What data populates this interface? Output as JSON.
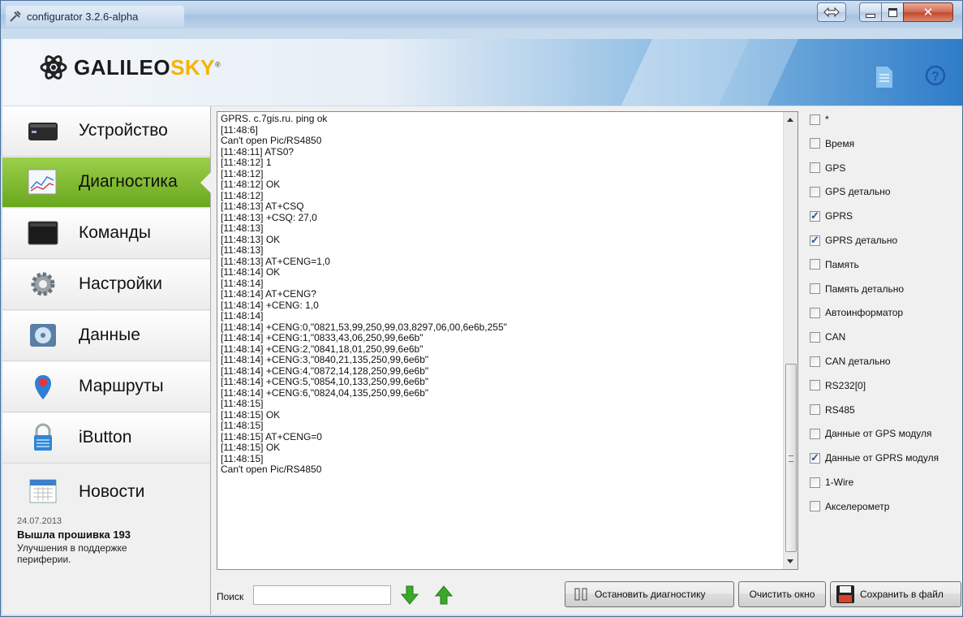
{
  "window": {
    "title": "configurator 3.2.6-alpha"
  },
  "brand": {
    "name_part1": "GALILEO",
    "name_part2": "SKY",
    "registered": "®"
  },
  "sidebar": {
    "items": [
      {
        "label": "Устройство",
        "icon": "device-icon",
        "active": false
      },
      {
        "label": "Диагностика",
        "icon": "chart-icon",
        "active": true
      },
      {
        "label": "Команды",
        "icon": "terminal-icon",
        "active": false
      },
      {
        "label": "Настройки",
        "icon": "gear-icon",
        "active": false
      },
      {
        "label": "Данные",
        "icon": "disk-icon",
        "active": false
      },
      {
        "label": "Маршруты",
        "icon": "map-pin-icon",
        "active": false
      },
      {
        "label": "iButton",
        "icon": "lock-icon",
        "active": false
      },
      {
        "label": "Новости",
        "icon": "calendar-icon",
        "active": false
      }
    ],
    "news": {
      "date": "24.07.2013",
      "title": "Вышла прошивка 193",
      "body": "Улучшения в поддержке периферии."
    }
  },
  "log": {
    "lines": [
      "GPRS. c.7gis.ru. ping ok",
      "[11:48:6]",
      "Can't open Pic/RS4850",
      "[11:48:11] ATS0?",
      "[11:48:12] 1",
      "[11:48:12]",
      "[11:48:12] OK",
      "[11:48:12]",
      "[11:48:13] AT+CSQ",
      "[11:48:13] +CSQ: 27,0",
      "[11:48:13]",
      "[11:48:13] OK",
      "[11:48:13]",
      "[11:48:13] AT+CENG=1,0",
      "[11:48:14] OK",
      "[11:48:14]",
      "[11:48:14] AT+CENG?",
      "[11:48:14] +CENG: 1,0",
      "[11:48:14]",
      "[11:48:14] +CENG:0,\"0821,53,99,250,99,03,8297,06,00,6e6b,255\"",
      "[11:48:14] +CENG:1,\"0833,43,06,250,99,6e6b\"",
      "[11:48:14] +CENG:2,\"0841,18,01,250,99,6e6b\"",
      "[11:48:14] +CENG:3,\"0840,21,135,250,99,6e6b\"",
      "[11:48:14] +CENG:4,\"0872,14,128,250,99,6e6b\"",
      "[11:48:14] +CENG:5,\"0854,10,133,250,99,6e6b\"",
      "[11:48:14] +CENG:6,\"0824,04,135,250,99,6e6b\"",
      "[11:48:15]",
      "[11:48:15] OK",
      "[11:48:15]",
      "[11:48:15] AT+CENG=0",
      "[11:48:15] OK",
      "[11:48:15]",
      "Can't open Pic/RS4850"
    ]
  },
  "filters": [
    {
      "label": "*",
      "checked": false
    },
    {
      "label": "Время",
      "checked": false
    },
    {
      "label": "GPS",
      "checked": false
    },
    {
      "label": "GPS детально",
      "checked": false
    },
    {
      "label": "GPRS",
      "checked": true
    },
    {
      "label": "GPRS детально",
      "checked": true
    },
    {
      "label": "Память",
      "checked": false
    },
    {
      "label": "Память детально",
      "checked": false
    },
    {
      "label": "Автоинформатор",
      "checked": false
    },
    {
      "label": "CAN",
      "checked": false
    },
    {
      "label": "CAN детально",
      "checked": false
    },
    {
      "label": "RS232[0]",
      "checked": false
    },
    {
      "label": "RS485",
      "checked": false
    },
    {
      "label": "Данные от GPS модуля",
      "checked": false
    },
    {
      "label": "Данные от GPRS модуля",
      "checked": true
    },
    {
      "label": "1-Wire",
      "checked": false
    },
    {
      "label": "Акселерометр",
      "checked": false
    }
  ],
  "toolbar": {
    "search_label": "Поиск",
    "search_value": "",
    "stop_label": "Остановить диагностику",
    "clear_label": "Очистить окно",
    "save_label": "Сохранить в файл"
  }
}
